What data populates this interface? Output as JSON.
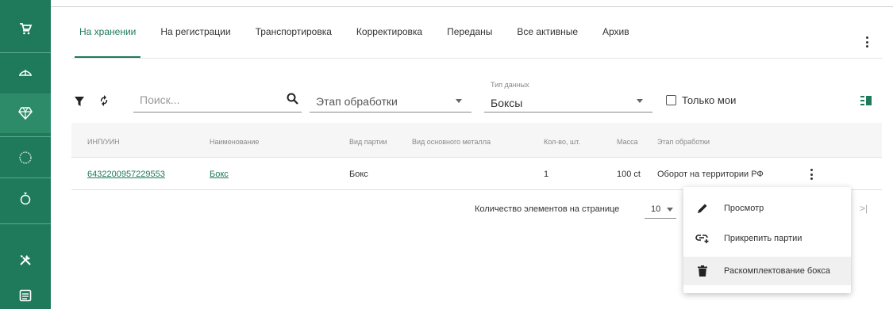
{
  "sidebar": {
    "items": [
      {
        "icon": "cart-icon"
      },
      {
        "icon": "scale-icon"
      },
      {
        "icon": "gem-icon",
        "active": true
      },
      {
        "icon": "circle-outline-icon"
      },
      {
        "icon": "ring-icon"
      },
      {
        "icon": "tools-icon"
      },
      {
        "icon": "document-icon"
      }
    ]
  },
  "tabs": [
    {
      "label": "На хранении",
      "active": true
    },
    {
      "label": "На регистрации"
    },
    {
      "label": "Транспортировка"
    },
    {
      "label": "Корректировка"
    },
    {
      "label": "Переданы"
    },
    {
      "label": "Все активные"
    },
    {
      "label": "Архив"
    }
  ],
  "filters": {
    "search_placeholder": "Поиск...",
    "stage_label": "Этап обработки",
    "data_type_floating_label": "Тип данных",
    "data_type_value": "Боксы",
    "only_mine_label": "Только мои"
  },
  "table": {
    "columns": [
      "ИНП/УИН",
      "Наименование",
      "Вид партии",
      "Вид основного металла",
      "Кол-во, шт.",
      "Масса",
      "Этап обработки"
    ],
    "rows": [
      {
        "inp": "6432200957229553",
        "name": "Бокс",
        "batch_type": "Бокс",
        "main_metal": "",
        "quantity": "1",
        "mass": "100 ct",
        "stage": "Оборот на территории РФ"
      }
    ]
  },
  "pagination": {
    "per_page_label": "Количество элементов на странице",
    "per_page_value": "10",
    "last_page_symbol": ">|"
  },
  "context_menu": {
    "items": [
      {
        "label": "Просмотр",
        "icon": "pencil-icon"
      },
      {
        "label": "Прикрепить партии",
        "icon": "link-add-icon"
      },
      {
        "label": "Раскомплектование бокса",
        "icon": "trash-icon",
        "hovered": true
      }
    ]
  },
  "colors": {
    "sidebar_bg": "#1f7a5c",
    "accent": "#1f7a5c",
    "link": "#1f7a5c"
  }
}
